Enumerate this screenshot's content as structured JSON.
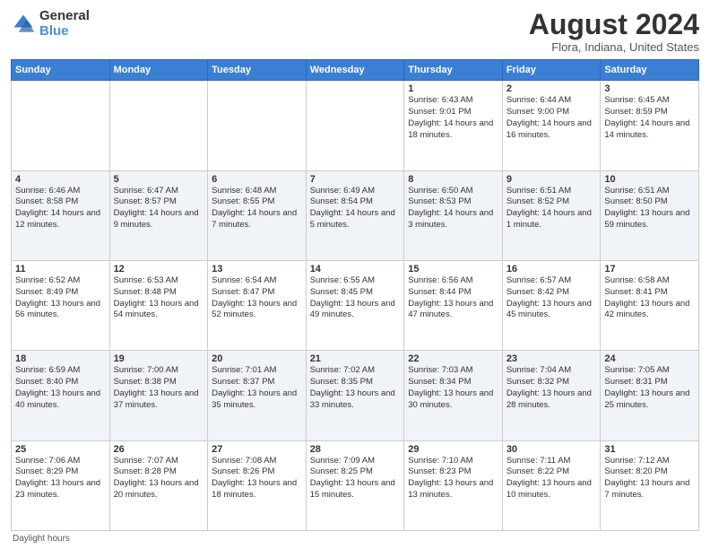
{
  "logo": {
    "general": "General",
    "blue": "Blue"
  },
  "title": "August 2024",
  "location": "Flora, Indiana, United States",
  "days_header": [
    "Sunday",
    "Monday",
    "Tuesday",
    "Wednesday",
    "Thursday",
    "Friday",
    "Saturday"
  ],
  "footer": "Daylight hours",
  "weeks": [
    [
      {
        "day": "",
        "info": ""
      },
      {
        "day": "",
        "info": ""
      },
      {
        "day": "",
        "info": ""
      },
      {
        "day": "",
        "info": ""
      },
      {
        "day": "1",
        "info": "Sunrise: 6:43 AM\nSunset: 9:01 PM\nDaylight: 14 hours and 18 minutes."
      },
      {
        "day": "2",
        "info": "Sunrise: 6:44 AM\nSunset: 9:00 PM\nDaylight: 14 hours and 16 minutes."
      },
      {
        "day": "3",
        "info": "Sunrise: 6:45 AM\nSunset: 8:59 PM\nDaylight: 14 hours and 14 minutes."
      }
    ],
    [
      {
        "day": "4",
        "info": "Sunrise: 6:46 AM\nSunset: 8:58 PM\nDaylight: 14 hours and 12 minutes."
      },
      {
        "day": "5",
        "info": "Sunrise: 6:47 AM\nSunset: 8:57 PM\nDaylight: 14 hours and 9 minutes."
      },
      {
        "day": "6",
        "info": "Sunrise: 6:48 AM\nSunset: 8:55 PM\nDaylight: 14 hours and 7 minutes."
      },
      {
        "day": "7",
        "info": "Sunrise: 6:49 AM\nSunset: 8:54 PM\nDaylight: 14 hours and 5 minutes."
      },
      {
        "day": "8",
        "info": "Sunrise: 6:50 AM\nSunset: 8:53 PM\nDaylight: 14 hours and 3 minutes."
      },
      {
        "day": "9",
        "info": "Sunrise: 6:51 AM\nSunset: 8:52 PM\nDaylight: 14 hours and 1 minute."
      },
      {
        "day": "10",
        "info": "Sunrise: 6:51 AM\nSunset: 8:50 PM\nDaylight: 13 hours and 59 minutes."
      }
    ],
    [
      {
        "day": "11",
        "info": "Sunrise: 6:52 AM\nSunset: 8:49 PM\nDaylight: 13 hours and 56 minutes."
      },
      {
        "day": "12",
        "info": "Sunrise: 6:53 AM\nSunset: 8:48 PM\nDaylight: 13 hours and 54 minutes."
      },
      {
        "day": "13",
        "info": "Sunrise: 6:54 AM\nSunset: 8:47 PM\nDaylight: 13 hours and 52 minutes."
      },
      {
        "day": "14",
        "info": "Sunrise: 6:55 AM\nSunset: 8:45 PM\nDaylight: 13 hours and 49 minutes."
      },
      {
        "day": "15",
        "info": "Sunrise: 6:56 AM\nSunset: 8:44 PM\nDaylight: 13 hours and 47 minutes."
      },
      {
        "day": "16",
        "info": "Sunrise: 6:57 AM\nSunset: 8:42 PM\nDaylight: 13 hours and 45 minutes."
      },
      {
        "day": "17",
        "info": "Sunrise: 6:58 AM\nSunset: 8:41 PM\nDaylight: 13 hours and 42 minutes."
      }
    ],
    [
      {
        "day": "18",
        "info": "Sunrise: 6:59 AM\nSunset: 8:40 PM\nDaylight: 13 hours and 40 minutes."
      },
      {
        "day": "19",
        "info": "Sunrise: 7:00 AM\nSunset: 8:38 PM\nDaylight: 13 hours and 37 minutes."
      },
      {
        "day": "20",
        "info": "Sunrise: 7:01 AM\nSunset: 8:37 PM\nDaylight: 13 hours and 35 minutes."
      },
      {
        "day": "21",
        "info": "Sunrise: 7:02 AM\nSunset: 8:35 PM\nDaylight: 13 hours and 33 minutes."
      },
      {
        "day": "22",
        "info": "Sunrise: 7:03 AM\nSunset: 8:34 PM\nDaylight: 13 hours and 30 minutes."
      },
      {
        "day": "23",
        "info": "Sunrise: 7:04 AM\nSunset: 8:32 PM\nDaylight: 13 hours and 28 minutes."
      },
      {
        "day": "24",
        "info": "Sunrise: 7:05 AM\nSunset: 8:31 PM\nDaylight: 13 hours and 25 minutes."
      }
    ],
    [
      {
        "day": "25",
        "info": "Sunrise: 7:06 AM\nSunset: 8:29 PM\nDaylight: 13 hours and 23 minutes."
      },
      {
        "day": "26",
        "info": "Sunrise: 7:07 AM\nSunset: 8:28 PM\nDaylight: 13 hours and 20 minutes."
      },
      {
        "day": "27",
        "info": "Sunrise: 7:08 AM\nSunset: 8:26 PM\nDaylight: 13 hours and 18 minutes."
      },
      {
        "day": "28",
        "info": "Sunrise: 7:09 AM\nSunset: 8:25 PM\nDaylight: 13 hours and 15 minutes."
      },
      {
        "day": "29",
        "info": "Sunrise: 7:10 AM\nSunset: 8:23 PM\nDaylight: 13 hours and 13 minutes."
      },
      {
        "day": "30",
        "info": "Sunrise: 7:11 AM\nSunset: 8:22 PM\nDaylight: 13 hours and 10 minutes."
      },
      {
        "day": "31",
        "info": "Sunrise: 7:12 AM\nSunset: 8:20 PM\nDaylight: 13 hours and 7 minutes."
      }
    ]
  ]
}
